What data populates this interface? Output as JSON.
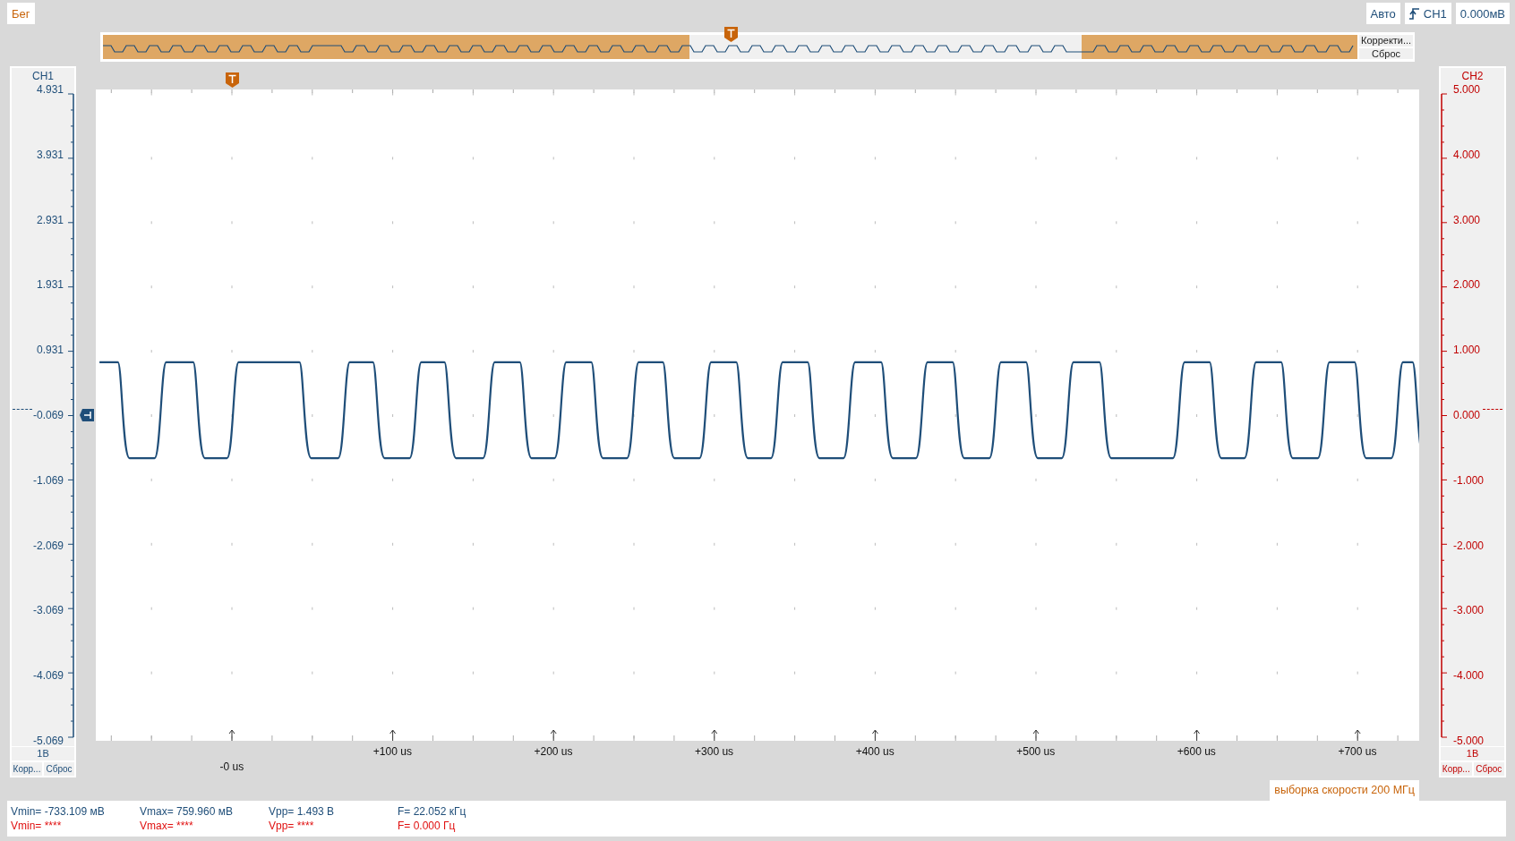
{
  "toolbar": {
    "run_button": "Бег",
    "trigger_mode": "Авто",
    "trigger_source": "CH1",
    "trigger_level": "0.000мВ"
  },
  "overview": {
    "adjust_button": "Корректи...",
    "reset_button": "Сброс"
  },
  "channels": [
    {
      "name": "CH1",
      "color": "#1f4e79",
      "axis_labels": [
        "4.931",
        "3.931",
        "2.931",
        "1.931",
        "0.931",
        "-0.069",
        "-1.069",
        "-2.069",
        "-3.069",
        "-4.069",
        "-5.069"
      ],
      "scale": "1В",
      "adjust_button": "Корр...",
      "reset_button": "Сброс"
    },
    {
      "name": "CH2",
      "color": "#c00000",
      "axis_labels": [
        "5.000",
        "4.000",
        "3.000",
        "2.000",
        "1.000",
        "0.000",
        "-1.000",
        "-2.000",
        "-3.000",
        "-4.000",
        "-5.000"
      ],
      "scale": "1В",
      "adjust_button": "Корр...",
      "reset_button": "Сброс"
    }
  ],
  "x_axis": {
    "labels": [
      "-0 us",
      "+100 us",
      "+200 us",
      "+300 us",
      "+400 us",
      "+500 us",
      "+600 us",
      "+700 us"
    ]
  },
  "sample_rate": "выборка скорости 200 МГц",
  "measurements": [
    {
      "color": "#1f4e79",
      "items": [
        "Vmin= -733.109 мВ",
        "Vmax= 759.960 мВ",
        "Vpp= 1.493 В",
        "F= 22.052 кГц"
      ]
    },
    {
      "color": "#e01010",
      "items": [
        "Vmin= ****",
        "Vmax= ****",
        "Vpp= ****",
        "F= 0.000 Гц"
      ]
    }
  ]
}
